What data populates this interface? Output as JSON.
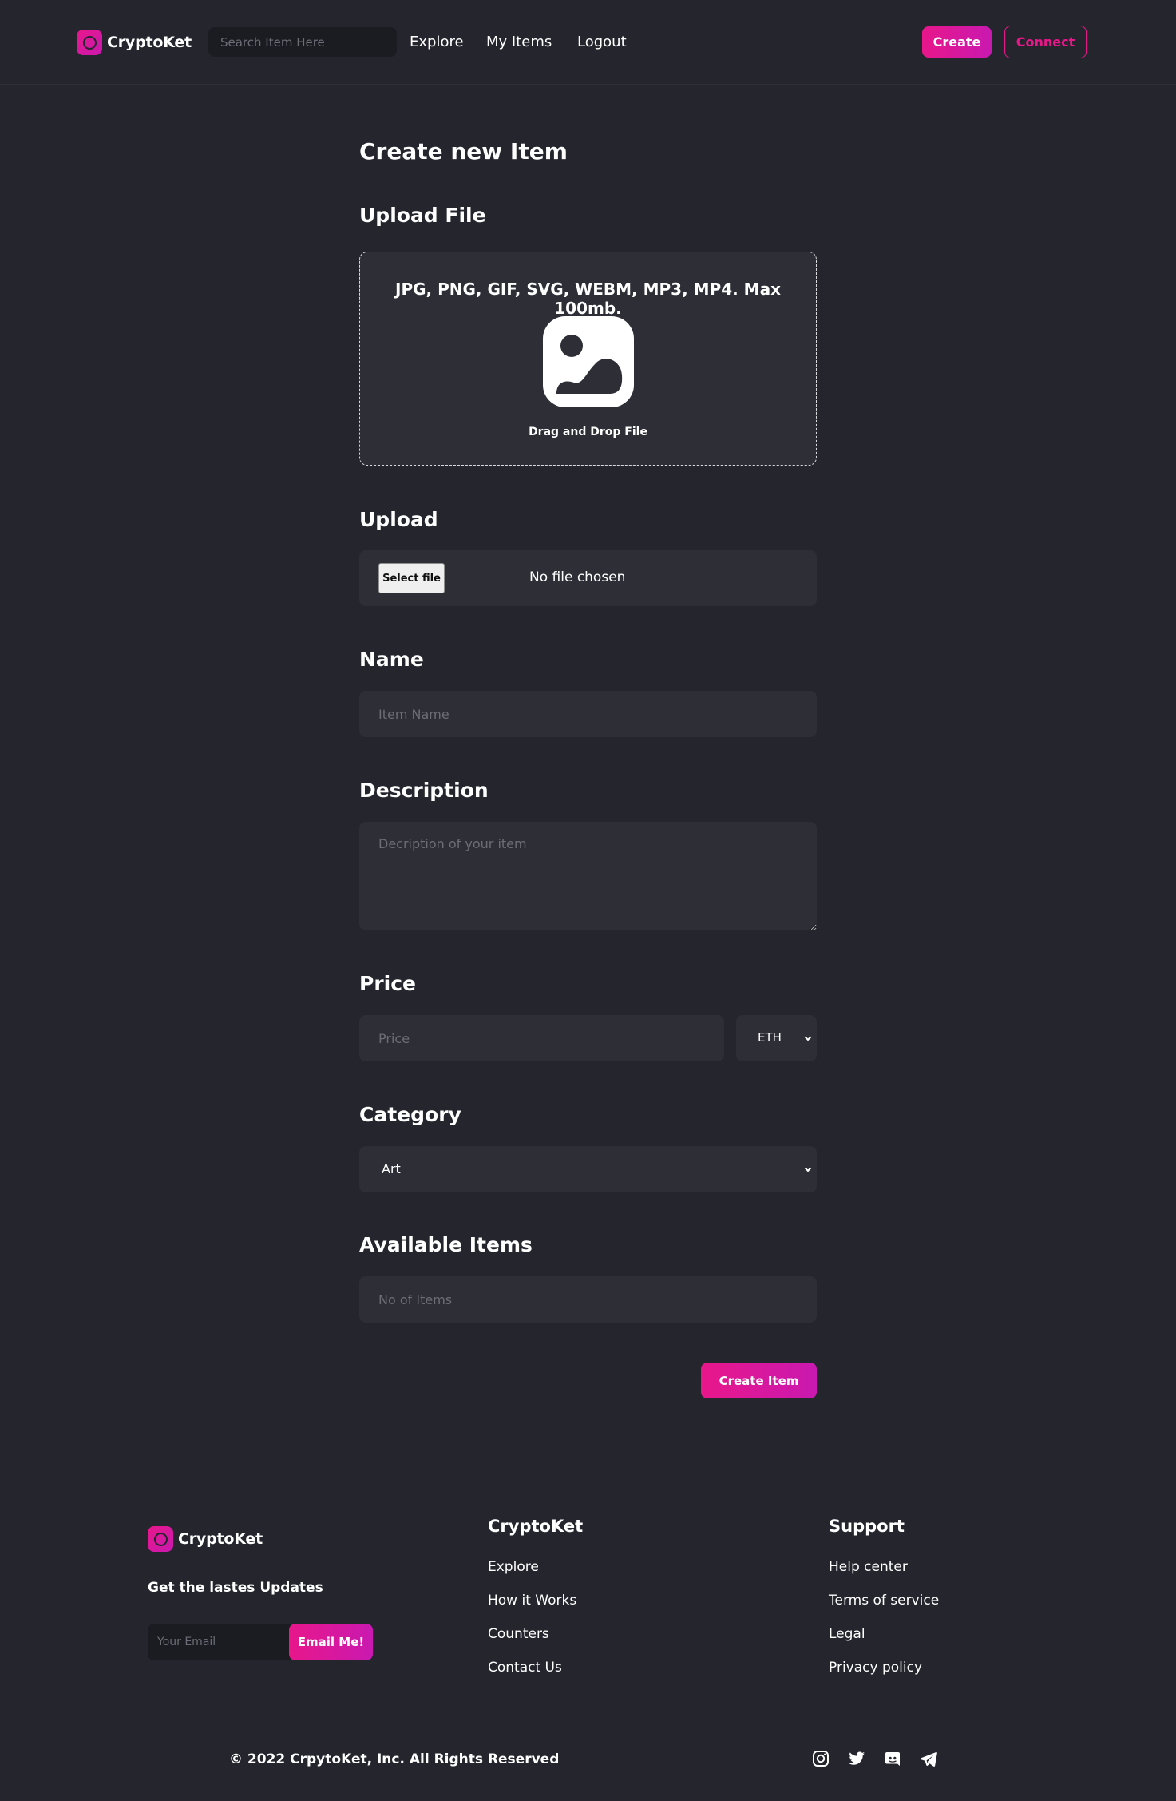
{
  "header": {
    "brand": "CryptoKet",
    "search_placeholder": "Search Item Here",
    "nav": [
      "Explore",
      "My Items",
      "Logout"
    ],
    "create_label": "Create",
    "connect_label": "Connect"
  },
  "form": {
    "page_title": "Create new Item",
    "upload_file_label": "Upload File",
    "dropzone_formats": "JPG, PNG, GIF, SVG, WEBM, MP3, MP4. Max 100mb.",
    "dropzone_hint": "Drag and Drop File",
    "upload_label": "Upload",
    "select_file_label": "Select file",
    "file_status": "No file chosen",
    "name_label": "Name",
    "name_placeholder": "Item Name",
    "description_label": "Description",
    "description_placeholder": "Decription of your item",
    "price_label": "Price",
    "price_placeholder": "Price",
    "currency": "ETH",
    "category_label": "Category",
    "category_value": "Art",
    "available_label": "Available Items",
    "available_placeholder": "No of Items",
    "submit_label": "Create Item"
  },
  "footer": {
    "brand": "CryptoKet",
    "tagline": "Get the lastes Updates",
    "email_placeholder": "Your Email",
    "email_button": "Email Me!",
    "col1_heading": "CryptoKet",
    "col1_links": [
      "Explore",
      "How it Works",
      "Counters",
      "Contact Us"
    ],
    "col2_heading": "Support",
    "col2_links": [
      "Help center",
      "Terms of service",
      "Legal",
      "Privacy policy"
    ],
    "copyright": "© 2022 CrpytoKet, Inc. All Rights Reserved",
    "social_icons": [
      "instagram-icon",
      "twitter-icon",
      "discord-icon",
      "telegram-icon"
    ]
  },
  "colors": {
    "background": "#24252d",
    "surface": "#2d2e36",
    "accent": "#e8178a"
  }
}
